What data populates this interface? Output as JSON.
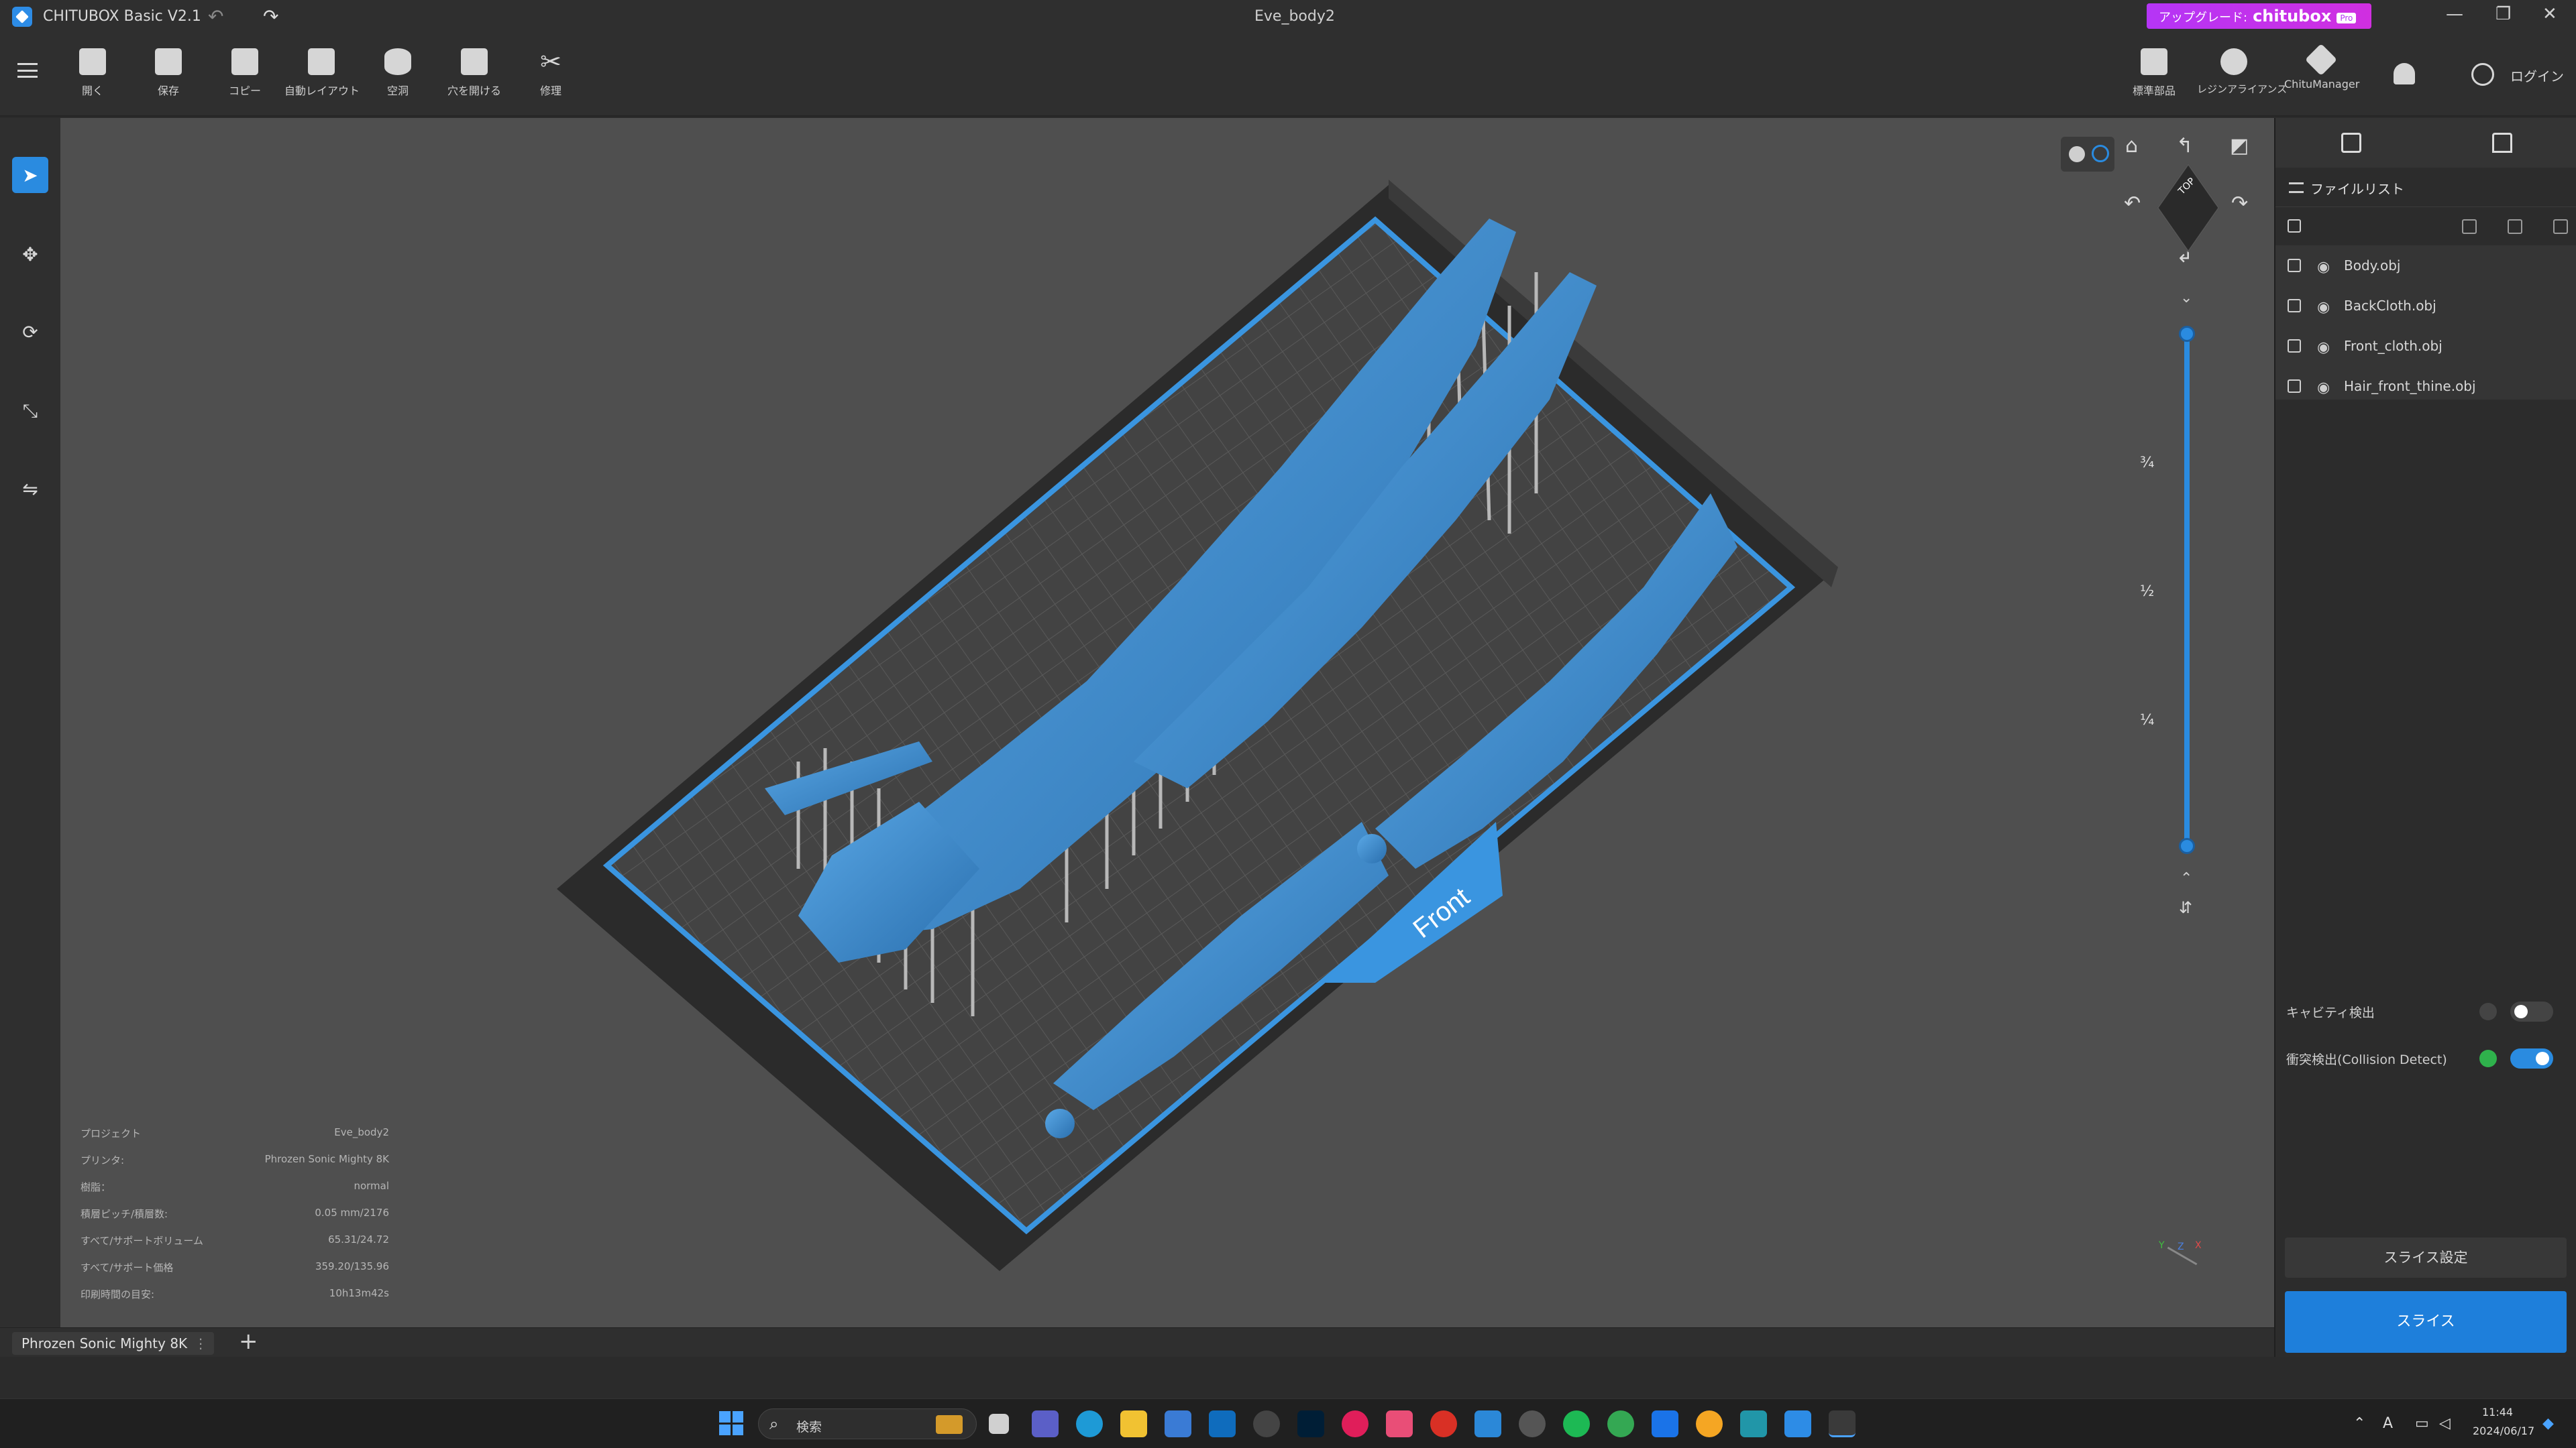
{
  "window": {
    "app_title": "CHITUBOX Basic V2.1",
    "doc_title": "Eve_body2",
    "upgrade_prefix": "アップグレード:",
    "upgrade_brand": "chitubox",
    "upgrade_pro": "Pro",
    "minimize": "—",
    "restore": "❐",
    "close": "✕",
    "undo": "↶",
    "redo": "↷"
  },
  "toolbar": {
    "left": [
      {
        "label": "開く",
        "icon": "folder-open-icon"
      },
      {
        "label": "保存",
        "icon": "save-icon"
      },
      {
        "label": "コピー",
        "icon": "copy-icon"
      },
      {
        "label": "自動レイアウト",
        "icon": "auto-layout-icon"
      },
      {
        "label": "空洞",
        "icon": "hollow-icon"
      },
      {
        "label": "穴を開ける",
        "icon": "dig-hole-icon"
      },
      {
        "label": "修理",
        "icon": "repair-icon"
      }
    ],
    "right": [
      {
        "label": "標準部品",
        "icon": "standard-parts-icon"
      },
      {
        "label": "レジンアライアンス",
        "icon": "resin-alliance-icon"
      },
      {
        "label": "ChituManager",
        "icon": "chitumanager-icon"
      }
    ],
    "login": "ログイン"
  },
  "side_tools": [
    {
      "name": "select-tool",
      "glyph": "➤"
    },
    {
      "name": "move-tool",
      "glyph": "✥"
    },
    {
      "name": "rotate-tool",
      "glyph": "⟳"
    },
    {
      "name": "scale-tool",
      "glyph": "⤡"
    },
    {
      "name": "mirror-tool",
      "glyph": "⇋"
    }
  ],
  "right_panel": {
    "file_list_title": "ファイルリスト",
    "files": [
      "Body.obj",
      "BackCloth.obj",
      "Front_cloth.obj",
      "Hair_front_thine.obj"
    ],
    "cavity_detect": "キャビティ検出",
    "collision_detect": "衝突検出(Collision Detect)",
    "slice_settings": "スライス設定",
    "slice": "スライス"
  },
  "viewport": {
    "plate_label": "Front",
    "cube_label": "TOP",
    "fractions": [
      "¾",
      "½",
      "¼"
    ],
    "axes": [
      "Y",
      "Z",
      "X"
    ]
  },
  "info": {
    "rows": [
      {
        "k": "プロジェクト",
        "v": "Eve_body2"
      },
      {
        "k": "プリンタ:",
        "v": "Phrozen Sonic Mighty 8K"
      },
      {
        "k": "樹脂：",
        "v": "normal"
      },
      {
        "k": "積層ピッチ/積層数:",
        "v": "0.05 mm/2176"
      },
      {
        "k": "すべて/サポートボリューム",
        "v": "65.31/24.72"
      },
      {
        "k": "すべて/サポート価格",
        "v": "359.20/135.96"
      },
      {
        "k": "印刷時間の目安:",
        "v": "10h13m42s"
      }
    ]
  },
  "tabs": {
    "printer": "Phrozen Sonic Mighty 8K",
    "more": "⋮",
    "add": "+"
  },
  "taskbar": {
    "search_placeholder": "検索",
    "time": "11:44",
    "date": "2024/06/17",
    "ime": "A"
  },
  "colors": {
    "accent": "#2a8be0",
    "model": "#3d8fd1",
    "support": "#a8a8a8",
    "upgrade": "#c632ec"
  }
}
